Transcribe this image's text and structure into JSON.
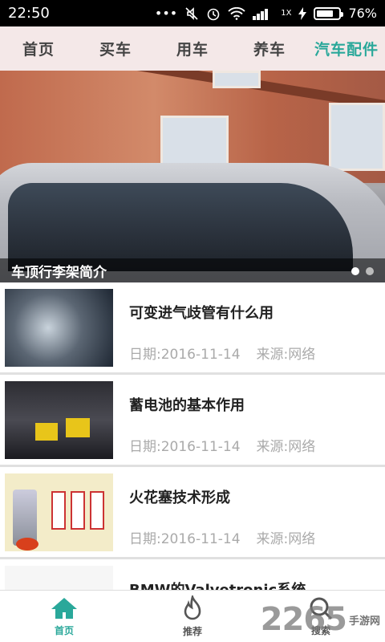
{
  "status": {
    "time": "22:50",
    "battery_percent": "76%",
    "battery_level": 0.76,
    "icons": [
      "ellipsis-icon",
      "mute-icon",
      "alarm-icon",
      "wifi-icon",
      "signal-icon",
      "charging-icon",
      "battery-icon"
    ],
    "signal_label": "1X"
  },
  "tabs": [
    {
      "label": "首页"
    },
    {
      "label": "买车"
    },
    {
      "label": "用车"
    },
    {
      "label": "养车"
    },
    {
      "label": "汽车配件",
      "active": true
    }
  ],
  "banner": {
    "caption": "车顶行李架简介",
    "dots": 2,
    "active_dot": 0
  },
  "articles": [
    {
      "title": "可变进气歧管有什么用",
      "date": "日期:2016-11-14",
      "source": "来源:网络",
      "thumb": "engine-image"
    },
    {
      "title": "蓄电池的基本作用",
      "date": "日期:2016-11-14",
      "source": "来源:网络",
      "thumb": "battery-image"
    },
    {
      "title": "火花塞技术形成",
      "date": "日期:2016-11-14",
      "source": "来源:网络",
      "thumb": "spark-plug-image"
    },
    {
      "title": "BMW的Valvetronic系统",
      "date": "",
      "source": "",
      "thumb": "valvetronic-image"
    }
  ],
  "bottom_nav": [
    {
      "label": "首页",
      "icon": "home-icon",
      "active": true
    },
    {
      "label": "推荐",
      "icon": "flame-icon"
    },
    {
      "label": "搜索",
      "icon": "search-icon"
    }
  ],
  "watermark": {
    "number": "2265",
    "text": "手游网"
  },
  "colors": {
    "accent": "#2aa89a",
    "tab_bg": "#f4e8e8"
  }
}
